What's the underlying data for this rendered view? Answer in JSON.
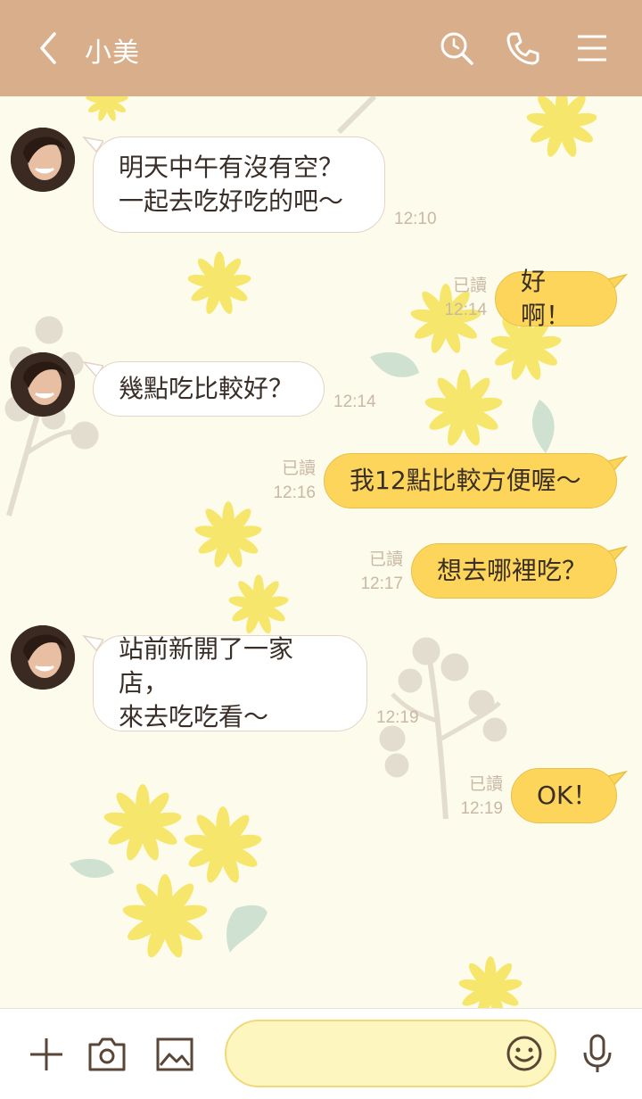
{
  "header": {
    "contact_name": "小美",
    "bg_color": "#d9af8b"
  },
  "messages": [
    {
      "side": "in",
      "lines": [
        "明天中午有沒有空？",
        "一起去吃好吃的吧〜"
      ],
      "time": "12:10"
    },
    {
      "side": "out",
      "lines": [
        "好啊！"
      ],
      "read": "已讀",
      "time": "12:14"
    },
    {
      "side": "in",
      "lines": [
        "幾點吃比較好？"
      ],
      "time": "12:14"
    },
    {
      "side": "out",
      "lines": [
        "我12點比較方便喔〜"
      ],
      "read": "已讀",
      "time": "12:16"
    },
    {
      "side": "out",
      "lines": [
        "想去哪裡吃？"
      ],
      "read": "已讀",
      "time": "12:17"
    },
    {
      "side": "in",
      "lines": [
        "站前新開了一家店，",
        "來去吃吃看〜"
      ],
      "time": "12:19"
    },
    {
      "side": "out",
      "lines": [
        "OK！"
      ],
      "read": "已讀",
      "time": "12:19"
    }
  ],
  "input": {
    "value": "",
    "placeholder": ""
  },
  "colors": {
    "incoming_bubble": "#ffffff",
    "outgoing_bubble": "#fdd55a",
    "chat_bg": "#fdfbec",
    "meta_text": "#c9b8a5"
  },
  "icons": {
    "back": "chevron-left-icon",
    "search": "search-icon",
    "call": "phone-icon",
    "menu": "menu-icon",
    "add": "plus-icon",
    "camera": "camera-icon",
    "gallery": "image-icon",
    "emoji": "smiley-icon",
    "voice": "microphone-icon"
  }
}
